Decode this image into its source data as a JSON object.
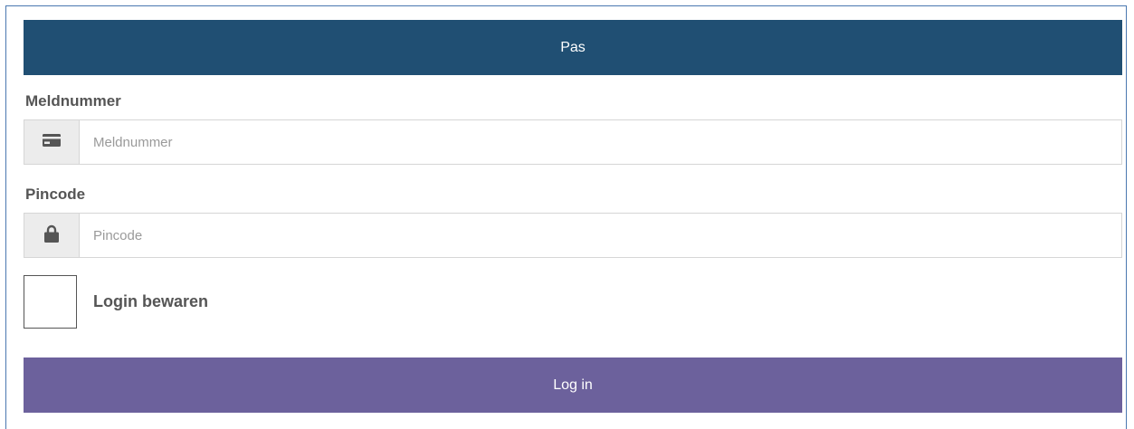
{
  "header": {
    "tab_label": "Pas",
    "color": "#204f73"
  },
  "form": {
    "meldnummer": {
      "label": "Meldnummer",
      "placeholder": "Meldnummer",
      "value": "",
      "icon": "card-icon"
    },
    "pincode": {
      "label": "Pincode",
      "placeholder": "Pincode",
      "value": "",
      "icon": "lock-icon"
    },
    "remember": {
      "label": "Login bewaren",
      "checked": false
    },
    "submit": {
      "label": "Log in",
      "color": "#6c619c"
    }
  }
}
